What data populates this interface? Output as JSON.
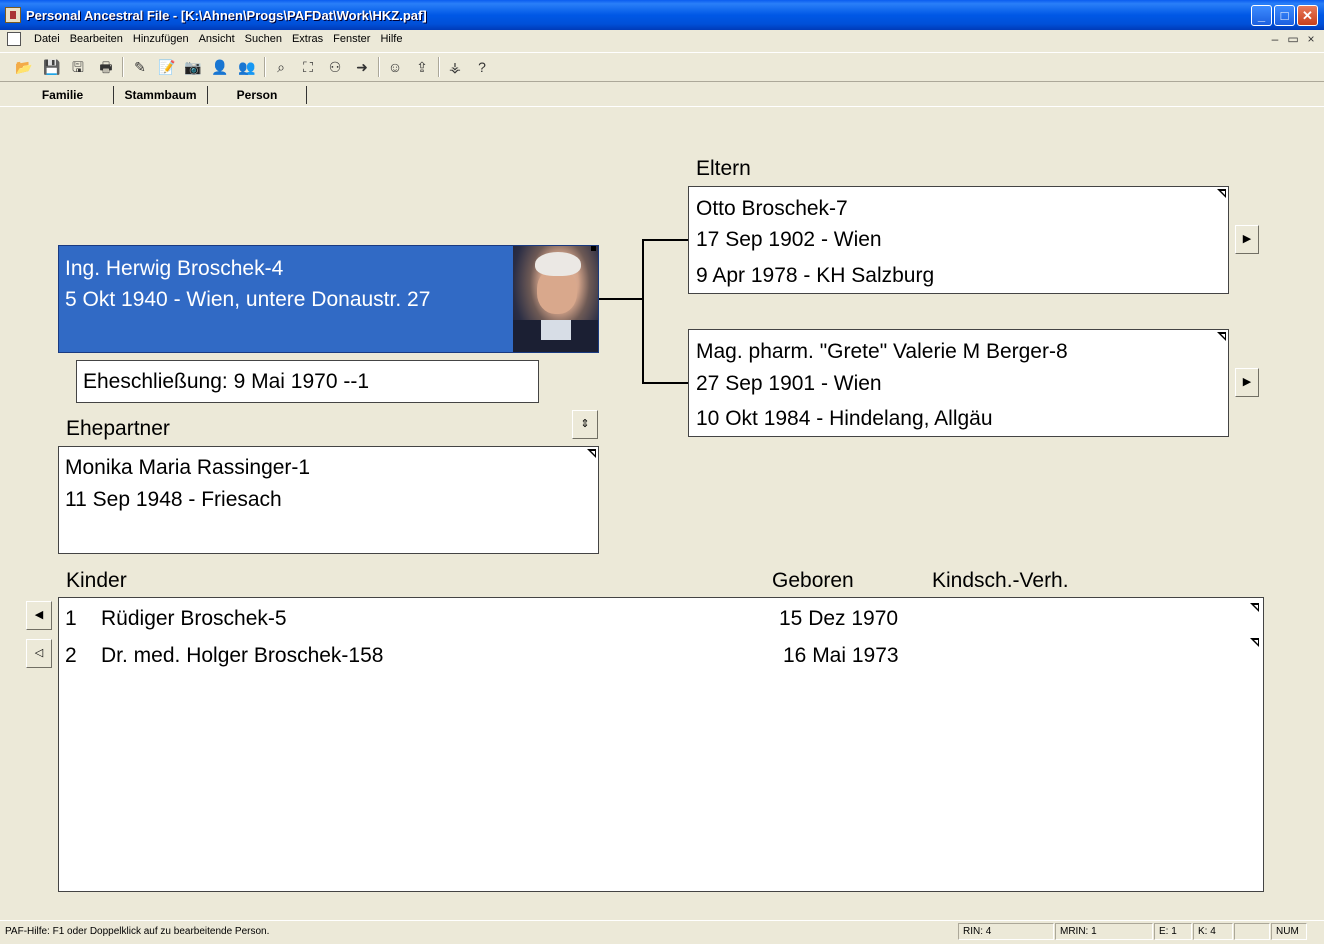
{
  "window": {
    "title": "Personal Ancestral File - [K:\\Ahnen\\Progs\\PAFDat\\Work\\HKZ.paf]",
    "controls": {
      "minimize": "_",
      "maximize": "□",
      "close": "✕"
    }
  },
  "menu": {
    "items": [
      "Datei",
      "Bearbeiten",
      "Hinzufügen",
      "Ansicht",
      "Suchen",
      "Extras",
      "Fenster",
      "Hilfe"
    ],
    "mdi_controls": [
      "–",
      "▭",
      "×"
    ]
  },
  "toolbar": {
    "icons": [
      "open-folder-icon",
      "save-icon",
      "save-as-icon",
      "print-icon",
      "edit-individual-icon",
      "notes-icon",
      "camera-icon",
      "add-person-icon",
      "add-couple-icon",
      "search-binoculars-icon",
      "find-family-icon",
      "find-relatives-icon",
      "go-to-person-icon",
      "individual-info-icon",
      "export-icon",
      "pedigree-chart-icon",
      "help-icon"
    ]
  },
  "tabs": [
    "Familie",
    "Stammbaum",
    "Person"
  ],
  "primary": {
    "name": "Ing. Herwig Broschek-4",
    "birth": "5 Okt 1940 - Wien, untere Donaustr. 27"
  },
  "marriage": "Eheschließung: 9 Mai 1970 --1",
  "spouse": {
    "heading": "Ehepartner",
    "name": "Monika Maria Rassinger-1",
    "birth": "11 Sep 1948 - Friesach"
  },
  "parents": {
    "heading": "Eltern",
    "father": {
      "name": "Otto Broschek-7",
      "birth": "17 Sep 1902 - Wien",
      "death": "9 Apr 1978 - KH Salzburg"
    },
    "mother": {
      "name": "Mag. pharm. \"Grete\" Valerie M Berger-8",
      "birth": "27 Sep 1901 - Wien",
      "death": "10 Okt 1984 - Hindelang, Allgäu"
    }
  },
  "children": {
    "headers": {
      "name": "Kinder",
      "born": "Geboren",
      "relation": "Kindsch.-Verh."
    },
    "rows": [
      {
        "num": "1",
        "name": "Rüdiger Broschek-5",
        "born": "15 Dez 1970"
      },
      {
        "num": "2",
        "name": "Dr. med. Holger Broschek-158",
        "born": "16 Mai 1973"
      }
    ]
  },
  "statusbar": {
    "help": "PAF-Hilfe: F1 oder Doppelklick auf zu bearbeitende Person.",
    "rin": "RIN: 4",
    "mrin": "MRIN: 1",
    "e": "E: 1",
    "k": "K: 4",
    "num": "NUM"
  }
}
